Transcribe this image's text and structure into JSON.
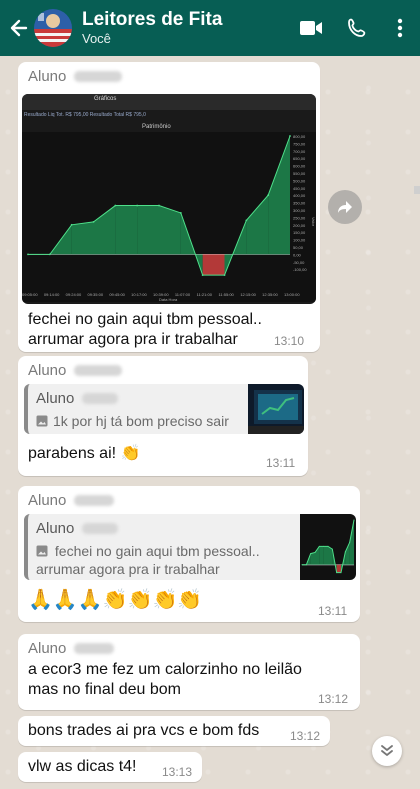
{
  "header": {
    "title": "Leitores de Fita",
    "subtitle": "Você",
    "colors": {
      "bar": "#075e54"
    }
  },
  "messages": [
    {
      "sender": "Aluno",
      "text": "fechei no gain aqui tbm pessoal.. arrumar agora pra ir trabalhar",
      "time": "13:10",
      "image": {
        "tabs": [
          "Gráficos"
        ],
        "toolbar_text": "Resultado Liq Tot. R$ 795,00  Resultado Total R$ 795,0",
        "chart_title": "Patrimônio",
        "chart_data": {
          "type": "area",
          "title": "Patrimônio",
          "xlabel": "Data Hora",
          "ylabel": "Valor",
          "x": [
            "09:05:00",
            "09:14:00",
            "09:24:00",
            "09:35:00",
            "09:45:00",
            "10:17:00",
            "10:39:00",
            "11:07:00",
            "11:21:00",
            "11:55:00",
            "12:15:00",
            "12:35:00",
            "13:00:00"
          ],
          "y": [
            0,
            0,
            200,
            220,
            330,
            330,
            330,
            280,
            -140,
            -140,
            230,
            400,
            800
          ],
          "ylim": [
            -200,
            800
          ],
          "yticks": [
            "800,00",
            "750,00",
            "700,00",
            "650,00",
            "600,00",
            "550,00",
            "500,00",
            "450,00",
            "400,00",
            "350,00",
            "300,00",
            "250,00",
            "200,00",
            "150,00",
            "100,00",
            "50,00",
            "0,00",
            "-50,00",
            "-100,00"
          ]
        }
      }
    },
    {
      "sender": "Aluno",
      "quote": {
        "sender": "Aluno",
        "text": "1k por hj tá bom preciso sair"
      },
      "text": "parabens ai! 👏",
      "time": "13:11"
    },
    {
      "sender": "Aluno",
      "quote": {
        "sender": "Aluno",
        "text": "fechei no gain aqui tbm pessoal.. arrumar agora pra ir trabalhar"
      },
      "text": "🙏🙏🙏👏👏👏👏",
      "time": "13:11"
    },
    {
      "sender": "Aluno",
      "text": "a ecor3 me fez um calorzinho no leilão mas no final deu bom",
      "time": "13:12"
    },
    {
      "text": "bons trades ai pra vcs e bom fds",
      "time": "13:12"
    },
    {
      "text": "vlw as dicas t4!",
      "time": "13:13"
    }
  ],
  "icons": {
    "back": "arrow-left-icon",
    "video": "video-camera-icon",
    "call": "phone-icon",
    "menu": "more-vert-icon",
    "forward": "forward-arrow-icon",
    "scroll": "double-chevron-down-icon"
  }
}
